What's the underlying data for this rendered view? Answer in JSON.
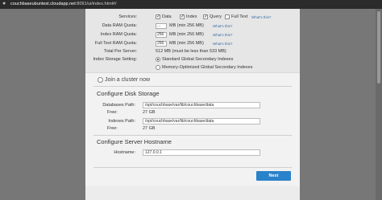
{
  "browser": {
    "url_host": "couchbaseubuntest.cloudapp.net",
    "url_rest": ":8091/ui/index.html#/"
  },
  "memory": {
    "services_label": "Services:",
    "services": [
      {
        "label": "Data",
        "checked": true
      },
      {
        "label": "Index",
        "checked": true
      },
      {
        "label": "Query",
        "checked": true
      },
      {
        "label": "Full Text",
        "checked": false
      }
    ],
    "whats_this": "What's this?",
    "data_ram_label": "Data RAM Quota:",
    "data_ram_value": "...",
    "data_ram_hint": "MB (min 256 MB)",
    "index_ram_label": "Index RAM Quota:",
    "index_ram_value": "256",
    "index_ram_hint": "MB (min 256 MB)",
    "fulltext_ram_label": "Full Text RAM Quota:",
    "fulltext_ram_value": "256",
    "fulltext_ram_hint": "MB (min 256 MB)",
    "total_label": "Total Per Server:",
    "total_value": "512 MB (must be less than 533 MB)",
    "storage_label": "Index Storage Setting:",
    "storage_options": [
      {
        "label": "Standard Global Secondary Indexes",
        "selected": true
      },
      {
        "label": "Memory-Optimized Global Secondary Indexes",
        "selected": false
      }
    ]
  },
  "join_cluster": "Join a cluster now",
  "disk": {
    "heading": "Configure Disk Storage",
    "db_path_label": "Databases Path:",
    "db_path_value": "/opt/couchbase/var/lib/couchbase/data",
    "db_free_label": "Free:",
    "db_free_value": "27 GB",
    "idx_path_label": "Indexes Path:",
    "idx_path_value": "/opt/couchbase/var/lib/couchbase/data",
    "idx_free_label": "Free:",
    "idx_free_value": "27 GB"
  },
  "host": {
    "heading": "Configure Server Hostname",
    "hostname_label": "Hostname:",
    "hostname_value": "127.0.0.1"
  },
  "next_button": "Next"
}
